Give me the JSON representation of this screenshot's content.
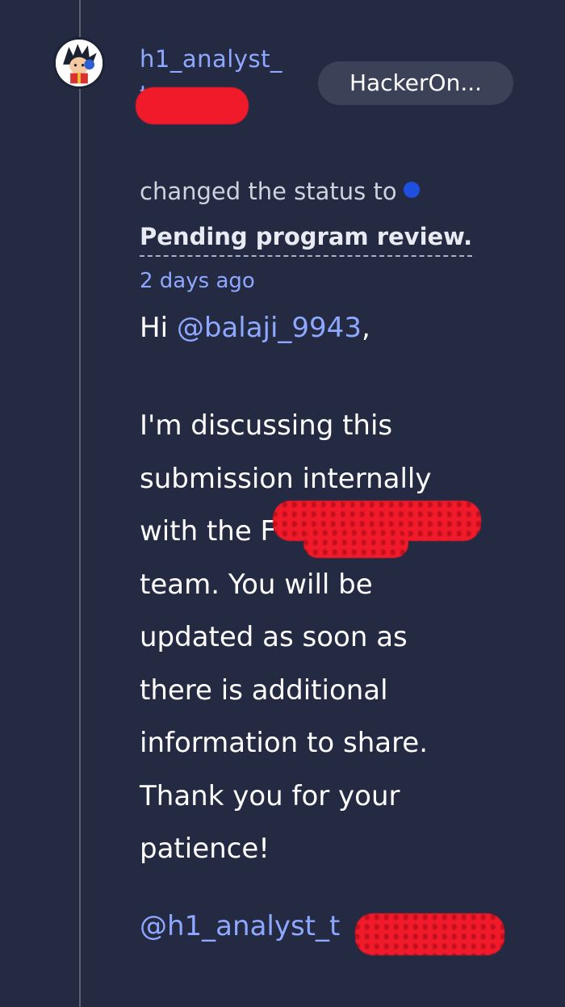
{
  "comment": {
    "author_name": "h1_analyst_",
    "author_name_line2": "t",
    "org_badge": "HackerOn...",
    "status_action": "changed the status to",
    "status_value": "Pending program review.",
    "status_dot_color": "#1f4fe0",
    "timestamp": "2 days ago",
    "greeting_prefix": "Hi ",
    "greeting_mention": "@balaji_9943",
    "greeting_suffix": ",",
    "body_lines": [
      "I'm discussing this",
      "submission internally",
      "with the F",
      "team. You will be",
      "updated as soon as",
      "there is additional",
      "information to share.",
      "Thank you for your",
      "patience!"
    ],
    "signature_mention": "@h1_analyst_t"
  }
}
